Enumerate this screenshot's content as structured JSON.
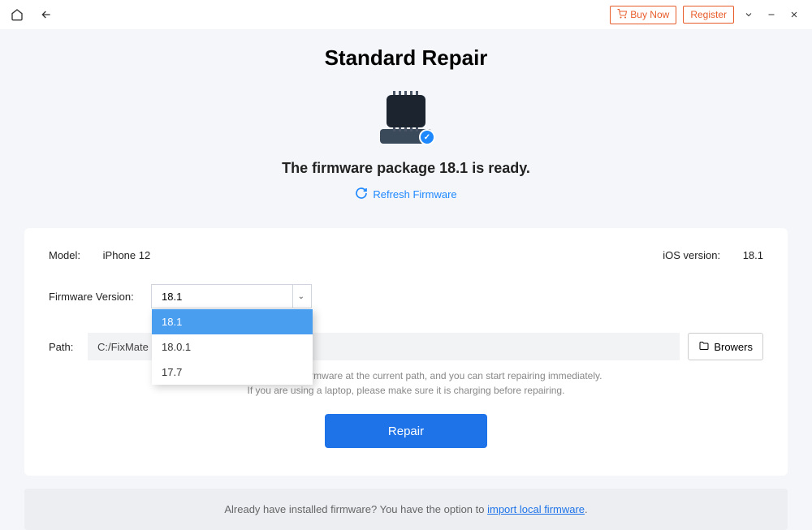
{
  "titlebar": {
    "buy_label": "Buy Now",
    "register_label": "Register"
  },
  "page": {
    "title": "Standard Repair",
    "ready_message": "The firmware package 18.1 is ready.",
    "refresh_label": "Refresh Firmware"
  },
  "card": {
    "model_label": "Model:",
    "model_value": "iPhone 12",
    "ios_label": "iOS version:",
    "ios_value": "18.1",
    "fw_label": "Firmware Version:",
    "fw_selected": "18.1",
    "fw_options": [
      "18.1",
      "18.0.1",
      "17.7"
    ],
    "path_label": "Path:",
    "path_value": "C:/FixMate",
    "browse_label": "Browers",
    "tip_line1": "Tip:There are already firmware at the current path, and you can start repairing immediately.",
    "tip_line2": "If you are using a laptop, please make sure it is charging before repairing.",
    "repair_label": "Repair"
  },
  "footer": {
    "text_prefix": "Already have installed firmware? You have the option to ",
    "link_text": "import local firmware",
    "text_suffix": "."
  }
}
